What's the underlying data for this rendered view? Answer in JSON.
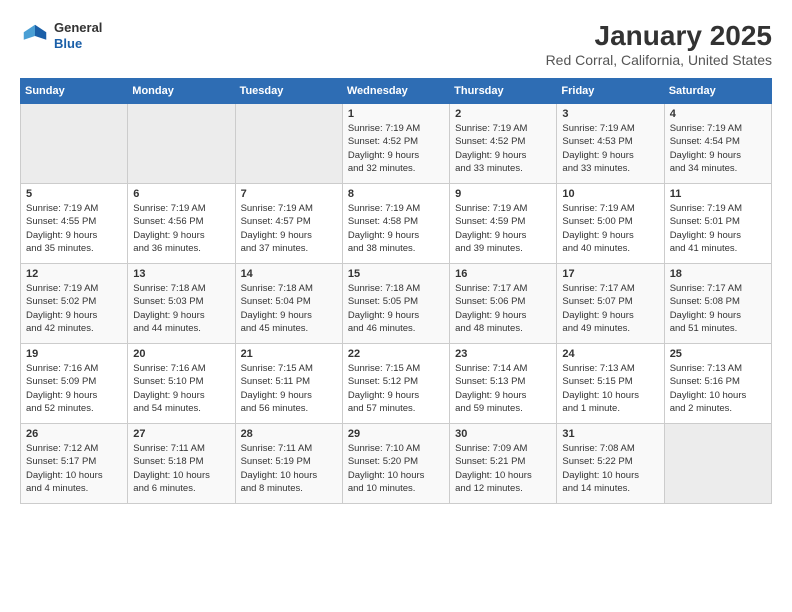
{
  "logo": {
    "general": "General",
    "blue": "Blue"
  },
  "header": {
    "title": "January 2025",
    "subtitle": "Red Corral, California, United States"
  },
  "weekdays": [
    "Sunday",
    "Monday",
    "Tuesday",
    "Wednesday",
    "Thursday",
    "Friday",
    "Saturday"
  ],
  "weeks": [
    [
      {
        "day": "",
        "info": ""
      },
      {
        "day": "",
        "info": ""
      },
      {
        "day": "",
        "info": ""
      },
      {
        "day": "1",
        "info": "Sunrise: 7:19 AM\nSunset: 4:52 PM\nDaylight: 9 hours\nand 32 minutes."
      },
      {
        "day": "2",
        "info": "Sunrise: 7:19 AM\nSunset: 4:52 PM\nDaylight: 9 hours\nand 33 minutes."
      },
      {
        "day": "3",
        "info": "Sunrise: 7:19 AM\nSunset: 4:53 PM\nDaylight: 9 hours\nand 33 minutes."
      },
      {
        "day": "4",
        "info": "Sunrise: 7:19 AM\nSunset: 4:54 PM\nDaylight: 9 hours\nand 34 minutes."
      }
    ],
    [
      {
        "day": "5",
        "info": "Sunrise: 7:19 AM\nSunset: 4:55 PM\nDaylight: 9 hours\nand 35 minutes."
      },
      {
        "day": "6",
        "info": "Sunrise: 7:19 AM\nSunset: 4:56 PM\nDaylight: 9 hours\nand 36 minutes."
      },
      {
        "day": "7",
        "info": "Sunrise: 7:19 AM\nSunset: 4:57 PM\nDaylight: 9 hours\nand 37 minutes."
      },
      {
        "day": "8",
        "info": "Sunrise: 7:19 AM\nSunset: 4:58 PM\nDaylight: 9 hours\nand 38 minutes."
      },
      {
        "day": "9",
        "info": "Sunrise: 7:19 AM\nSunset: 4:59 PM\nDaylight: 9 hours\nand 39 minutes."
      },
      {
        "day": "10",
        "info": "Sunrise: 7:19 AM\nSunset: 5:00 PM\nDaylight: 9 hours\nand 40 minutes."
      },
      {
        "day": "11",
        "info": "Sunrise: 7:19 AM\nSunset: 5:01 PM\nDaylight: 9 hours\nand 41 minutes."
      }
    ],
    [
      {
        "day": "12",
        "info": "Sunrise: 7:19 AM\nSunset: 5:02 PM\nDaylight: 9 hours\nand 42 minutes."
      },
      {
        "day": "13",
        "info": "Sunrise: 7:18 AM\nSunset: 5:03 PM\nDaylight: 9 hours\nand 44 minutes."
      },
      {
        "day": "14",
        "info": "Sunrise: 7:18 AM\nSunset: 5:04 PM\nDaylight: 9 hours\nand 45 minutes."
      },
      {
        "day": "15",
        "info": "Sunrise: 7:18 AM\nSunset: 5:05 PM\nDaylight: 9 hours\nand 46 minutes."
      },
      {
        "day": "16",
        "info": "Sunrise: 7:17 AM\nSunset: 5:06 PM\nDaylight: 9 hours\nand 48 minutes."
      },
      {
        "day": "17",
        "info": "Sunrise: 7:17 AM\nSunset: 5:07 PM\nDaylight: 9 hours\nand 49 minutes."
      },
      {
        "day": "18",
        "info": "Sunrise: 7:17 AM\nSunset: 5:08 PM\nDaylight: 9 hours\nand 51 minutes."
      }
    ],
    [
      {
        "day": "19",
        "info": "Sunrise: 7:16 AM\nSunset: 5:09 PM\nDaylight: 9 hours\nand 52 minutes."
      },
      {
        "day": "20",
        "info": "Sunrise: 7:16 AM\nSunset: 5:10 PM\nDaylight: 9 hours\nand 54 minutes."
      },
      {
        "day": "21",
        "info": "Sunrise: 7:15 AM\nSunset: 5:11 PM\nDaylight: 9 hours\nand 56 minutes."
      },
      {
        "day": "22",
        "info": "Sunrise: 7:15 AM\nSunset: 5:12 PM\nDaylight: 9 hours\nand 57 minutes."
      },
      {
        "day": "23",
        "info": "Sunrise: 7:14 AM\nSunset: 5:13 PM\nDaylight: 9 hours\nand 59 minutes."
      },
      {
        "day": "24",
        "info": "Sunrise: 7:13 AM\nSunset: 5:15 PM\nDaylight: 10 hours\nand 1 minute."
      },
      {
        "day": "25",
        "info": "Sunrise: 7:13 AM\nSunset: 5:16 PM\nDaylight: 10 hours\nand 2 minutes."
      }
    ],
    [
      {
        "day": "26",
        "info": "Sunrise: 7:12 AM\nSunset: 5:17 PM\nDaylight: 10 hours\nand 4 minutes."
      },
      {
        "day": "27",
        "info": "Sunrise: 7:11 AM\nSunset: 5:18 PM\nDaylight: 10 hours\nand 6 minutes."
      },
      {
        "day": "28",
        "info": "Sunrise: 7:11 AM\nSunset: 5:19 PM\nDaylight: 10 hours\nand 8 minutes."
      },
      {
        "day": "29",
        "info": "Sunrise: 7:10 AM\nSunset: 5:20 PM\nDaylight: 10 hours\nand 10 minutes."
      },
      {
        "day": "30",
        "info": "Sunrise: 7:09 AM\nSunset: 5:21 PM\nDaylight: 10 hours\nand 12 minutes."
      },
      {
        "day": "31",
        "info": "Sunrise: 7:08 AM\nSunset: 5:22 PM\nDaylight: 10 hours\nand 14 minutes."
      },
      {
        "day": "",
        "info": ""
      }
    ]
  ]
}
